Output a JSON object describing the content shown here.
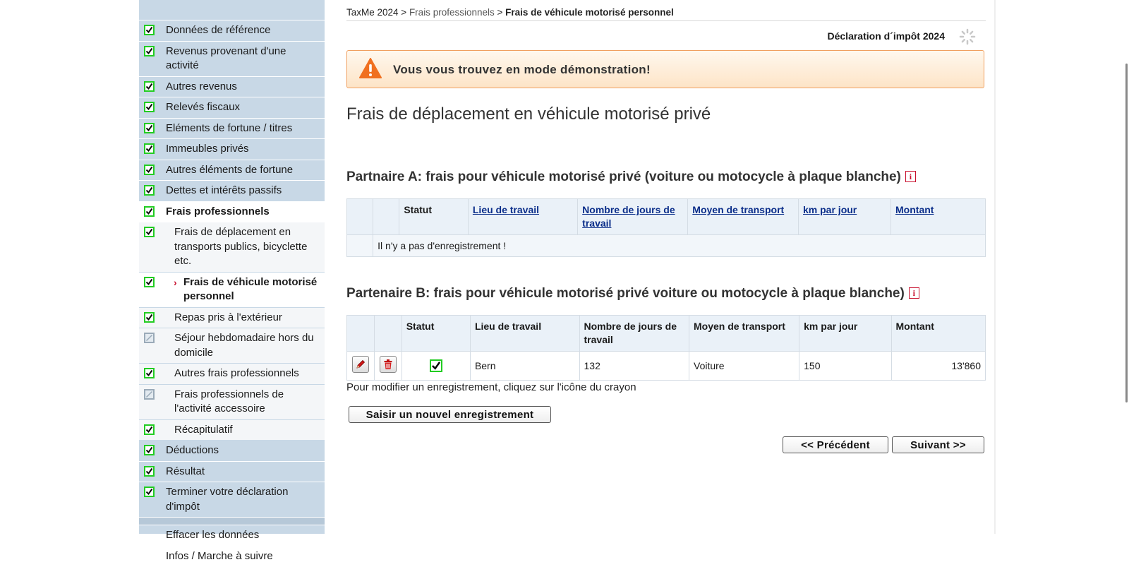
{
  "sidebar": {
    "items": [
      {
        "label": "Données de référence",
        "status": "done"
      },
      {
        "label": "Revenus provenant d'une activité",
        "status": "done"
      },
      {
        "label": "Autres revenus",
        "status": "done"
      },
      {
        "label": "Relevés fiscaux",
        "status": "done"
      },
      {
        "label": "Eléments de fortune / titres",
        "status": "done"
      },
      {
        "label": "Immeubles privés",
        "status": "done"
      },
      {
        "label": "Autres éléments de fortune",
        "status": "done"
      },
      {
        "label": "Dettes et intérêts passifs",
        "status": "done"
      },
      {
        "label": "Frais professionnels",
        "status": "done"
      }
    ],
    "subitems": [
      {
        "label": "Frais de déplacement en transports publics, bicyclette etc.",
        "status": "done"
      },
      {
        "label": "Frais de véhicule motorisé personnel",
        "status": "done",
        "current": true
      },
      {
        "label": "Repas pris à l'extérieur",
        "status": "done"
      },
      {
        "label": "Séjour hebdomadaire hors du domicile",
        "status": "disabled"
      },
      {
        "label": "Autres frais professionnels",
        "status": "done"
      },
      {
        "label": "Frais professionnels de l'activité accessoire",
        "status": "disabled"
      },
      {
        "label": "Récapitulatif",
        "status": "done"
      }
    ],
    "items_after": [
      {
        "label": "Déductions",
        "status": "done"
      },
      {
        "label": "Résultat",
        "status": "done"
      },
      {
        "label": "Terminer votre déclaration d'impôt",
        "status": "done"
      }
    ],
    "links": [
      "Effacer les données",
      "Infos / Marche à suivre"
    ]
  },
  "breadcrumb": {
    "root": "TaxMe 2024",
    "sep1": " > ",
    "middle": "Frais professionnels",
    "sep2": " > ",
    "current": "Frais de véhicule motorisé personnel"
  },
  "header": {
    "declaration": "Déclaration d´impôt 2024"
  },
  "demo_banner": "Vous vous trouvez en mode démonstration!",
  "page_title": "Frais de déplacement en véhicule motorisé privé",
  "partner_a": {
    "heading": "Partnaire A: frais pour véhicule motorisé privé (voiture ou motocycle à plaque blanche)",
    "columns": [
      "Statut",
      "Lieu de travail",
      "Nombre de jours de travail",
      "Moyen de transport",
      "km par jour",
      "Montant"
    ],
    "empty_message": "Il n'y a pas d'enregistrement !"
  },
  "partner_b": {
    "heading": "Partenaire B: frais pour véhicule motorisé privé voiture ou motocycle à plaque blanche)",
    "columns": [
      "Statut",
      "Lieu de travail",
      "Nombre de jours de travail",
      "Moyen de transport",
      "km par jour",
      "Montant"
    ],
    "rows": [
      {
        "lieu": "Bern",
        "jours": "132",
        "moyen": "Voiture",
        "km": "150",
        "montant": "13'860",
        "status": "done"
      }
    ]
  },
  "edit_hint": "Pour modifier un enregistrement, cliquez sur l'icône du crayon",
  "buttons": {
    "new_record": "Saisir un nouvel enregistrement",
    "previous": "<< Précédent",
    "next": "Suivant >>"
  },
  "icons": {
    "check": "checkbox-checked-icon",
    "disabled": "checkbox-disabled-icon",
    "edit": "pencil-icon",
    "delete": "trash-icon",
    "warning": "warning-icon",
    "info": "info-icon",
    "loading": "spinner-icon"
  },
  "colors": {
    "sidebar_bg": "#c8d8e6",
    "check_green": "#22cc22",
    "banner_border": "#f0a060",
    "info_red": "#c8102e",
    "link_blue": "#0b2e8a"
  }
}
